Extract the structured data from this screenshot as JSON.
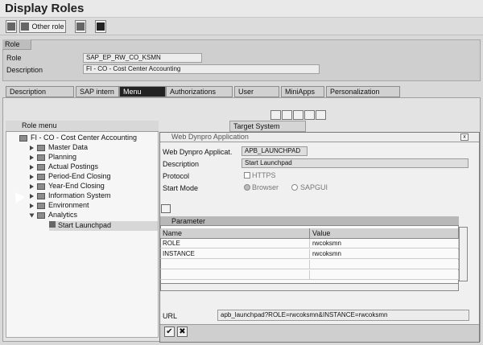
{
  "window": {
    "title": "Display Roles"
  },
  "toolbar": {
    "other_role_label": "Other role"
  },
  "role_section": {
    "header": "Role",
    "role_label": "Role",
    "role_value": "SAP_EP_RW_CO_KSMN",
    "desc_label": "Description",
    "desc_value": "FI - CO - Cost Center Accounting"
  },
  "tabs": [
    {
      "label": "Description"
    },
    {
      "label": "SAP intern"
    },
    {
      "label": "Menu"
    },
    {
      "label": "Authorizations"
    },
    {
      "label": "User"
    },
    {
      "label": "MiniApps"
    },
    {
      "label": "Personalization"
    }
  ],
  "tree": {
    "header": "Role menu",
    "root": "FI - CO - Cost Center Accounting",
    "items": [
      {
        "label": "Master Data"
      },
      {
        "label": "Planning"
      },
      {
        "label": "Actual Postings"
      },
      {
        "label": "Period-End Closing"
      },
      {
        "label": "Year-End Closing"
      },
      {
        "label": "Information System"
      },
      {
        "label": "Environment"
      },
      {
        "label": "Analytics"
      },
      {
        "label": "Start Launchpad"
      }
    ]
  },
  "target_system": {
    "label": "Target System"
  },
  "popup": {
    "title": "Web Dynpro Application",
    "app_label": "Web Dynpro Applicat.",
    "app_value": "APB_LAUNCHPAD",
    "desc_label": "Description",
    "desc_value": "Start Launchpad",
    "protocol_label": "Protocol",
    "https_label": "HTTPS",
    "start_mode_label": "Start Mode",
    "browser_label": "Browser",
    "sapgui_label": "SAPGUI",
    "param_title": "Parameter",
    "param_headers": [
      "Name",
      "Value"
    ],
    "params": [
      {
        "name": "ROLE",
        "value": "rwcoksmn"
      },
      {
        "name": "INSTANCE",
        "value": "rwcoksmn"
      }
    ],
    "url_label": "URL",
    "url_value": "apb_launchpad?ROLE=rwcoksmn&INSTANCE=rwcoksmn"
  },
  "icons": [
    "edit-icon",
    "display-icon",
    "hierarchy-icon",
    "info-icon",
    "zoom-icon",
    "copy-icon",
    "list-icon",
    "transport-icon",
    "settings-icon",
    "check-icon",
    "cancel-icon"
  ]
}
